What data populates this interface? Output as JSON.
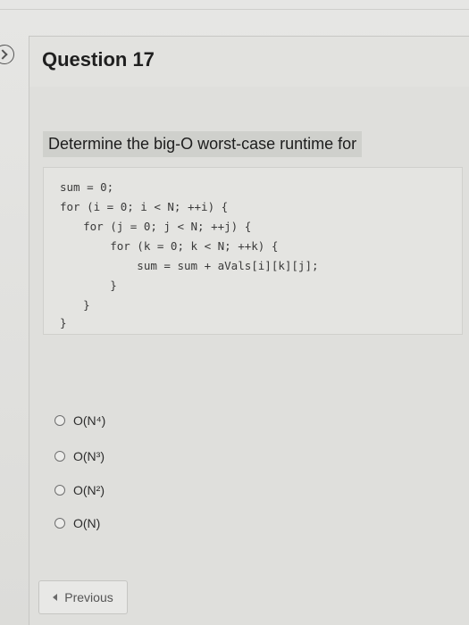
{
  "question": {
    "title": "Question 17",
    "prompt": "Determine the big-O worst-case runtime for"
  },
  "code": [
    "sum = 0;",
    "for (i = 0; i < N; ++i) {",
    "    for (j = 0; j < N; ++j) {",
    "        for (k = 0; k < N; ++k) {",
    "            sum = sum + aVals[i][k][j];",
    "        }",
    "    }",
    "}"
  ],
  "options": [
    {
      "label": "O(N⁴)"
    },
    {
      "label": "O(N³)"
    },
    {
      "label": "O(N²)"
    },
    {
      "label": "O(N)"
    }
  ],
  "navigation": {
    "previous_label": "Previous",
    "previous_icon": "chevron-left-icon"
  },
  "toggle_icon": "chevron-right-icon"
}
